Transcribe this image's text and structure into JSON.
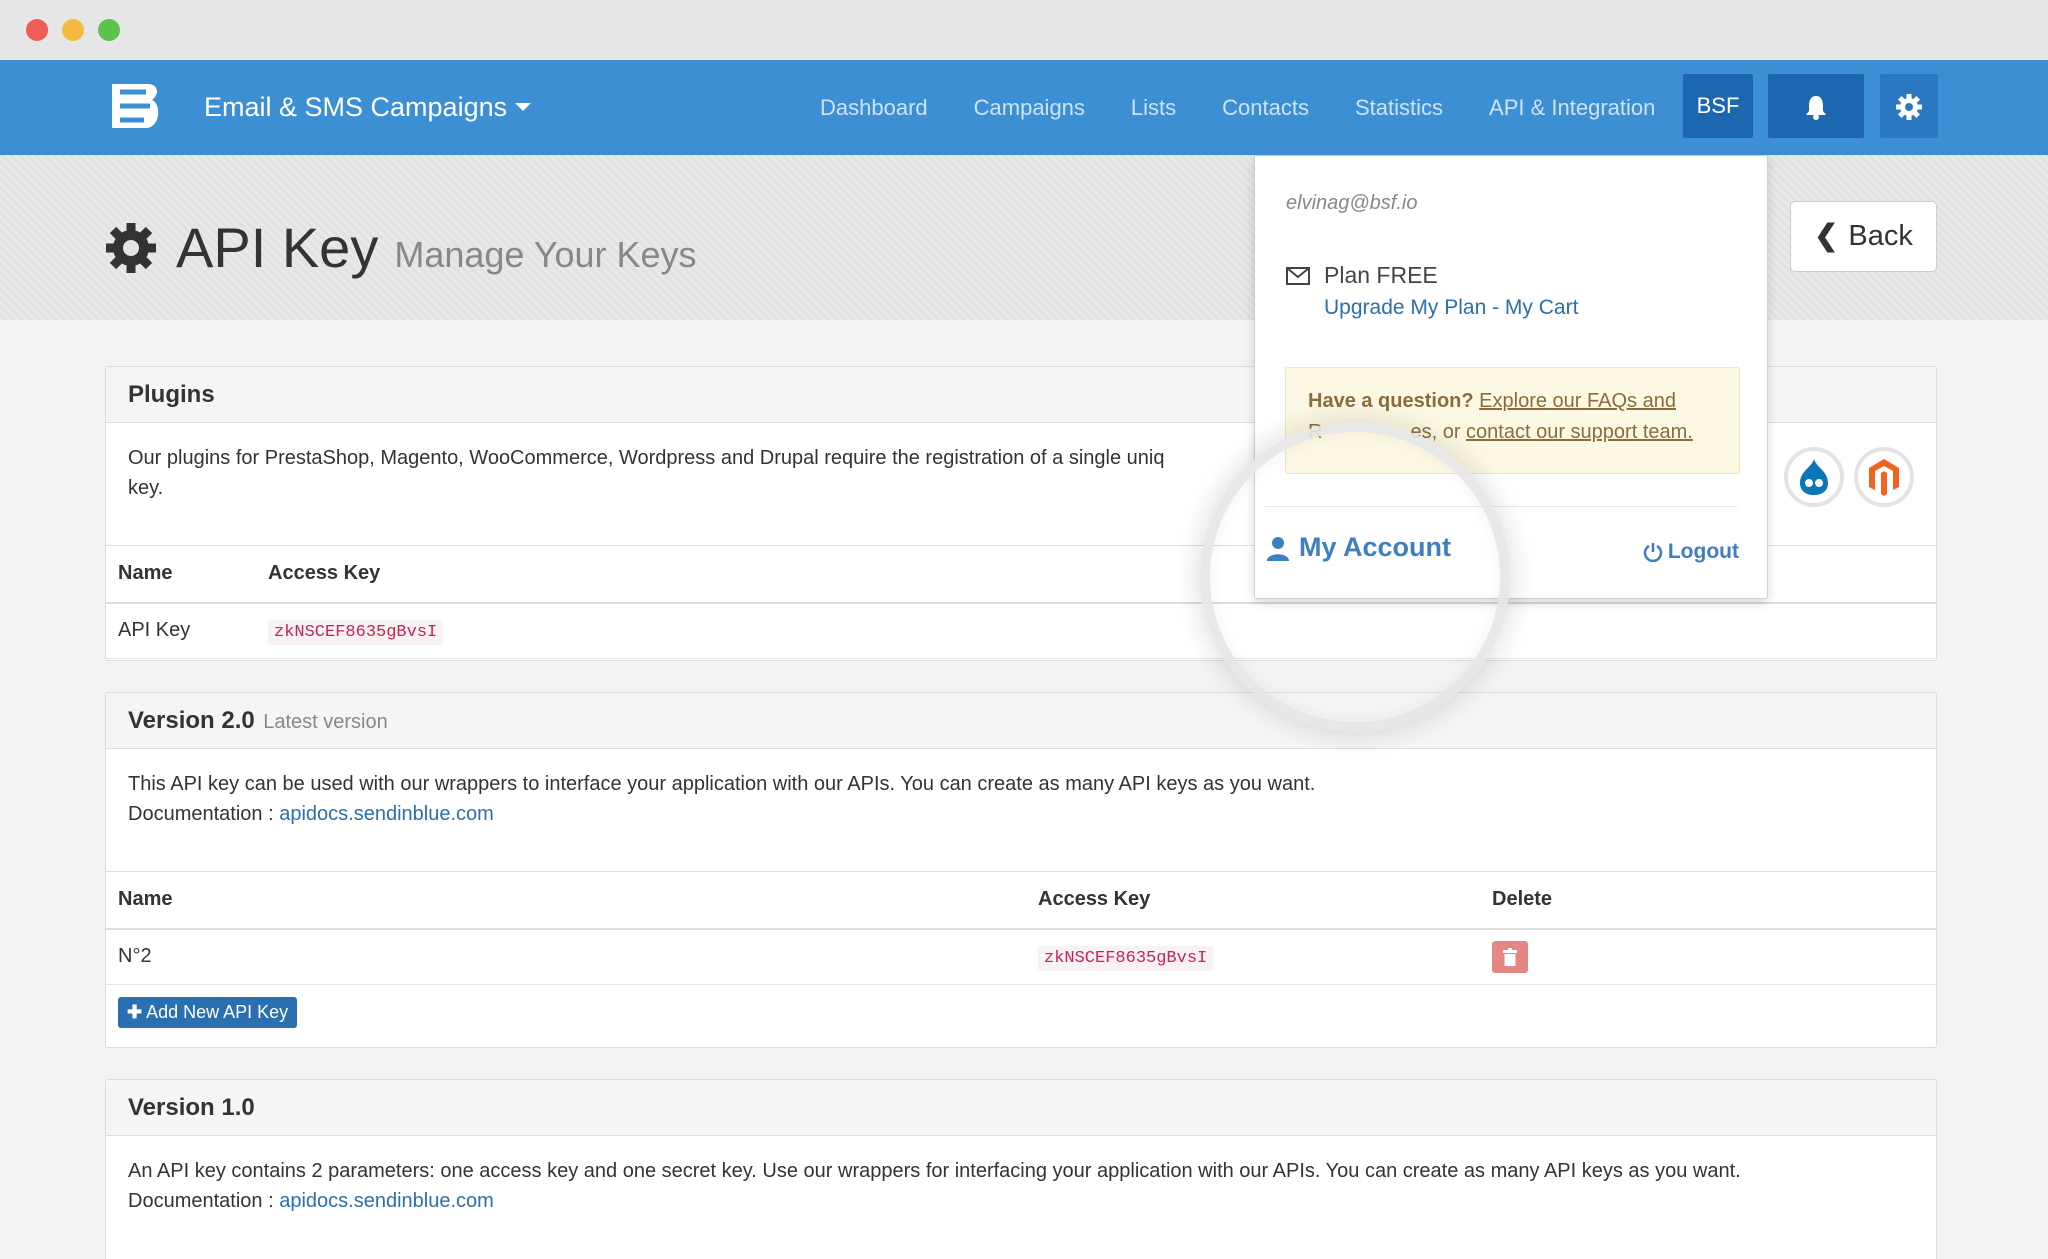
{
  "nav": {
    "brand": "Email & SMS Campaigns",
    "links": [
      "Dashboard",
      "Campaigns",
      "Lists",
      "Contacts",
      "Statistics",
      "API & Integration"
    ],
    "account_button": "BSF"
  },
  "header": {
    "title": "API Key",
    "subtitle": "Manage Your Keys",
    "back_label": "Back"
  },
  "plugins": {
    "title": "Plugins",
    "description_line1": "Our plugins for PrestaShop, Magento, WooCommerce, Wordpress and Drupal require the registration of a single uniq",
    "description_line2": "key.",
    "columns": [
      "Name",
      "Access Key"
    ],
    "rows": [
      {
        "name": "API Key",
        "access_key": "zkNSCEF8635gBvsI"
      }
    ]
  },
  "v2": {
    "title": "Version 2.0",
    "subtitle": "Latest version",
    "description": "This API key can be used with our wrappers to interface your application with our APIs. You can create as many API keys as you want.",
    "doc_label": "Documentation : ",
    "doc_link": "apidocs.sendinblue.com",
    "columns": [
      "Name",
      "Access Key",
      "Delete"
    ],
    "rows": [
      {
        "name": "N°2",
        "access_key": "zkNSCEF8635gBvsI"
      }
    ],
    "add_button": "Add New API Key"
  },
  "v1": {
    "title": "Version 1.0",
    "description": "An API key contains 2 parameters: one access key and one secret key. Use our wrappers for interfacing your application with our APIs. You can create as many API keys as you want.",
    "doc_label": "Documentation : ",
    "doc_link": "apidocs.sendinblue.com"
  },
  "dropdown": {
    "email": "elvinag@bsf.io",
    "plan": "Plan FREE",
    "upgrade": "Upgrade My Plan",
    "separator": " - ",
    "cart": "My Cart",
    "help_bold": "Have a question?",
    "help_link1": "Explore our FAQs and",
    "help_partial": "R",
    "help_partial_end": "es, or",
    "help_link2": "contact our support team.",
    "account": "My Account",
    "logout": "Logout"
  },
  "colors": {
    "navbar": "#3d8fd4",
    "nav_button": "#1d67b0",
    "link": "#2a6fb0",
    "key_code": "#c7254e"
  }
}
